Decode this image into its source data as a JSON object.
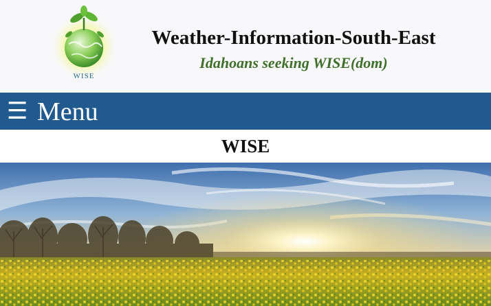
{
  "header": {
    "title": "Weather-Information-South-East",
    "tagline": "Idahoans seeking WISE(dom)",
    "logo_text": "WISE"
  },
  "menu": {
    "icon": "☰",
    "label": "Menu"
  },
  "page": {
    "title": "WISE"
  },
  "colors": {
    "menu_bar": "#215a8f",
    "tagline": "#3f6f2a",
    "header_bg": "#f8f8fb"
  },
  "icons": {
    "menu": "hamburger-icon",
    "logo": "globe-plant-logo"
  }
}
